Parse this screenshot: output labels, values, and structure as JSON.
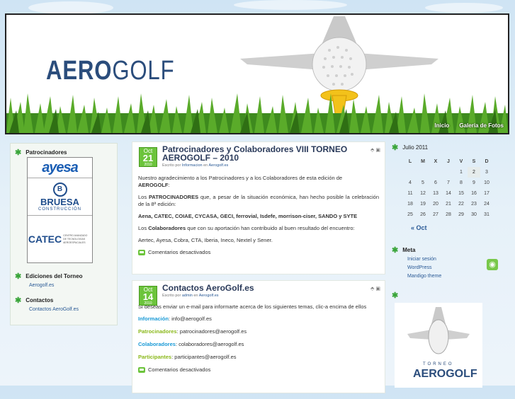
{
  "header": {
    "logo_part1": "AERO",
    "logo_part2": "GOLF",
    "nav": [
      "Inicio",
      "Galería de Fotos"
    ]
  },
  "left_sidebar": {
    "sponsors_title": "Patrocinadores",
    "sponsor_logos": [
      {
        "name": "ayesa"
      },
      {
        "name": "BRUESA",
        "sub": "CONSTRUCCIÓN",
        "letter": "B"
      },
      {
        "name": "CATEC",
        "sub": "CENTRO AVANZADO DE TECNOLOGÍAS AEROESPACIALES"
      }
    ],
    "editions_title": "Ediciones del Torneo",
    "editions_link": "Aerogolf.es",
    "contacts_title": "Contactos",
    "contacts_link": "Contactos AeroGolf.es"
  },
  "posts": [
    {
      "month": "Oct",
      "day": "21",
      "year": "2010",
      "title": "Patrocinadores y Colaboradores VIII TORNEO AEROGOLF – 2010",
      "meta_prefix": "Escrito por",
      "author": "Informacion",
      "meta_mid": "en",
      "category": "Aerogolf.es",
      "p1a": "Nuestro agradecimiento a los Patrocinadores y a los Colaboradores de esta edición de",
      "p1b": "AEROGOLF",
      "p1c": ":",
      "p2a": "PATROCINADORES",
      "p2b": " que, a pesar de la situación económica, han hecho posible la celebración de la 8ª edición:",
      "lead": "Los ",
      "p3": "Aena, CATEC, COIAE, CYCASA, GECI, ferrovial, Isdefe, morrison-ciser, SANDO y SYTE",
      "p4a": "Colaboradores",
      "p4b": " que con su aportación han contribuido al buen resultado del encuentro:",
      "p5": "Aertec, Ayesa, Cobra, CTA, Iberia, Ineco, Nextel y Sener.",
      "comments": "Comentarios desactivados"
    },
    {
      "month": "Oct",
      "day": "14",
      "year": "2010",
      "title": "Contactos AeroGolf.es",
      "meta_prefix": "Escrito por",
      "author": "admin",
      "meta_mid": "en",
      "category": "Aerogolf.es",
      "intro": "Si deseas enviar un e-mail para informarte acerca de los siguientes temas, clic-a encima de ellos",
      "contacts": [
        {
          "label": "Información",
          "email": "info@aerogolf.es",
          "color": "#1a9ad6"
        },
        {
          "label": "Patrocinadores",
          "email": "patrocinadores@aerogolf.es",
          "color": "#8ab81a"
        },
        {
          "label": "Colaboradores",
          "email": "colaboradores@aerogolf.es",
          "color": "#1a9ad6"
        },
        {
          "label": "Participantes",
          "email": "participantes@aerogolf.es",
          "color": "#8ab81a"
        }
      ],
      "comments": "Comentarios desactivados"
    }
  ],
  "right_sidebar": {
    "calendar_title": "Julio 2011",
    "weekdays": [
      "L",
      "M",
      "X",
      "J",
      "V",
      "S",
      "D"
    ],
    "weeks": [
      [
        "",
        "",
        "",
        "",
        "1",
        "2",
        "3"
      ],
      [
        "4",
        "5",
        "6",
        "7",
        "8",
        "9",
        "10"
      ],
      [
        "11",
        "12",
        "13",
        "14",
        "15",
        "16",
        "17"
      ],
      [
        "18",
        "19",
        "20",
        "21",
        "22",
        "23",
        "24"
      ],
      [
        "25",
        "26",
        "27",
        "28",
        "29",
        "30",
        "31"
      ]
    ],
    "today": "2",
    "prev_month": "« Oct",
    "meta_title": "Meta",
    "meta_links": [
      "Iniciar sesión",
      "WordPress",
      "Mandigo theme"
    ],
    "promo_line1": "TORNEO",
    "promo_line2": "AEROGOLF"
  },
  "colors": {
    "accent_green": "#6cc43c",
    "link_blue": "#2a5a96",
    "title_navy": "#2b4d7c"
  }
}
